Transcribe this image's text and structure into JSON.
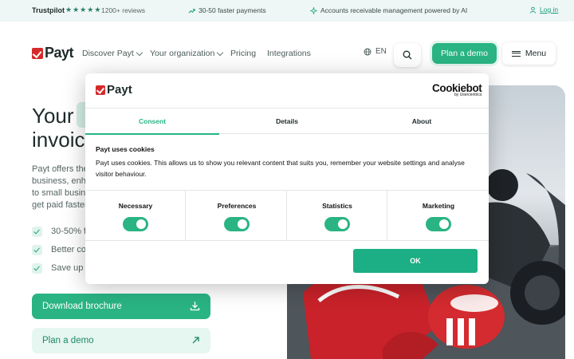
{
  "topbar": {
    "brand": "Trustpilot",
    "stars": [
      "★",
      "★",
      "★",
      "★",
      "★"
    ],
    "reviews": "1200+ reviews",
    "faster": "30-50 faster payments",
    "ai": "Accounts receivable management powered by AI",
    "login": "Log in"
  },
  "nav": {
    "logo": "Payt",
    "items": [
      "Discover Payt",
      "Your organization",
      "Pricing",
      "Integrations"
    ],
    "lang": "EN",
    "demo": "Plan a demo",
    "menu": "Menu"
  },
  "hero": {
    "title_1": "Your",
    "title_2": "invoic",
    "para": [
      "Payt offers the",
      "business, enha",
      "to small busine",
      "get paid faster"
    ],
    "checks": [
      "30-50% f",
      "Better co",
      "Save up t"
    ],
    "download": "Download brochure",
    "plan_demo": "Plan a demo"
  },
  "dialog": {
    "logo": "Payt",
    "cookiebot": "Cookiebot",
    "cookiebot_by": "by Usercentrics",
    "tabs": [
      "Consent",
      "Details",
      "About"
    ],
    "title": "Payt uses cookies",
    "body": "Payt uses cookies. This allows us to show you relevant content that suits you, remember your website settings and analyse visitor behaviour.",
    "toggles": [
      "Necessary",
      "Preferences",
      "Statistics",
      "Marketing"
    ],
    "ok": "OK"
  },
  "colors": {
    "accent": "#2ab483",
    "brand_red": "#d42a2a",
    "topbar_bg": "#eef7f5"
  }
}
